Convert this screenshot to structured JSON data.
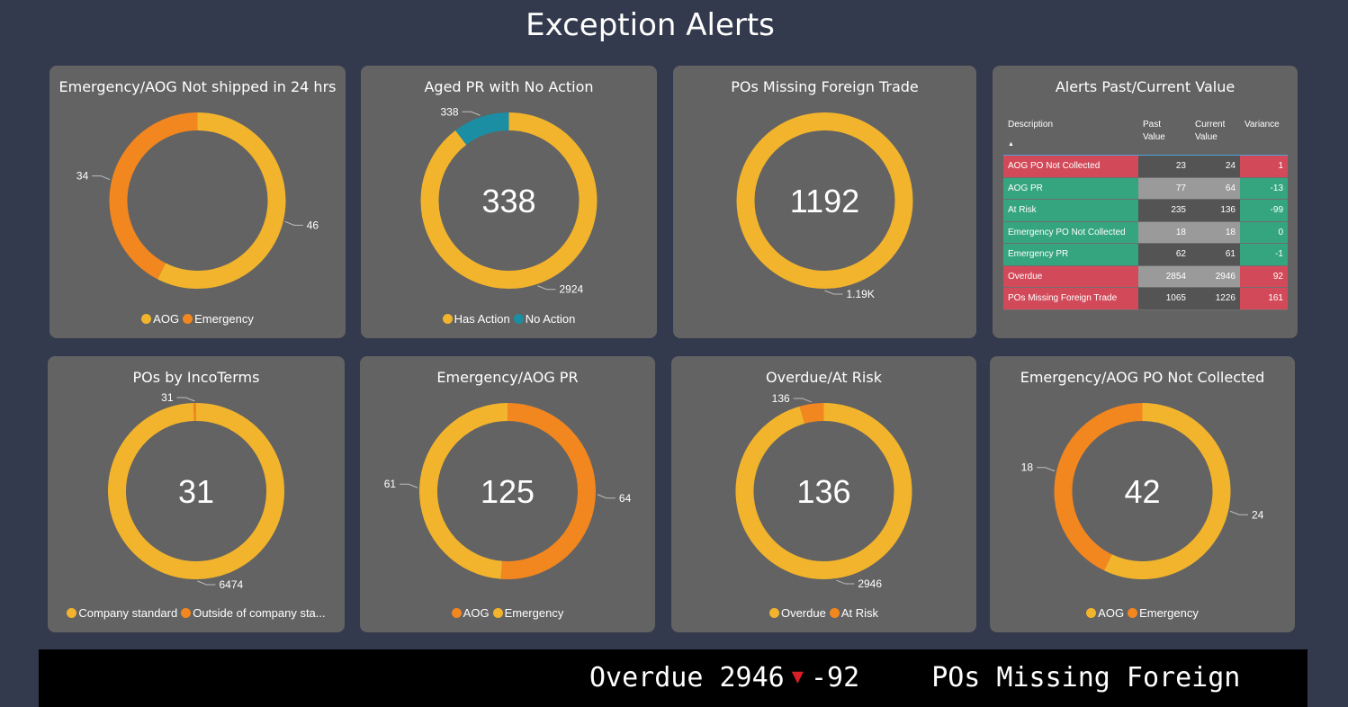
{
  "page": {
    "title": "Exception Alerts"
  },
  "colors": {
    "yellow": "#f2b42c",
    "orange": "#f2861f",
    "teal": "#1b8ea3",
    "red_cell": "#d24a59",
    "green_cell": "#35a580",
    "dark_cell": "#545454",
    "gray_cell": "#9a9a9a",
    "background": "#343a4d",
    "card": "#636363"
  },
  "charts": [
    {
      "title": "Emergency/AOG Not shipped in 24 hrs",
      "center": "",
      "slices": [
        {
          "name": "AOG",
          "value": 46,
          "label": "46",
          "color": "#f2b42c"
        },
        {
          "name": "Emergency",
          "value": 34,
          "label": "34",
          "color": "#f2861f"
        }
      ],
      "legend": [
        {
          "label": "AOG",
          "color": "#f2b42c"
        },
        {
          "label": "Emergency",
          "color": "#f2861f"
        }
      ]
    },
    {
      "title": "Aged PR with No Action",
      "center": "338",
      "slices": [
        {
          "name": "Has Action",
          "value": 2924,
          "label": "2924",
          "color": "#f2b42c"
        },
        {
          "name": "No Action",
          "value": 338,
          "label": "338",
          "color": "#1b8ea3"
        }
      ],
      "legend": [
        {
          "label": "Has Action",
          "color": "#f2b42c"
        },
        {
          "label": "No Action",
          "color": "#1b8ea3"
        }
      ]
    },
    {
      "title": "POs Missing Foreign Trade",
      "center": "1192",
      "slices": [
        {
          "name": "POs Missing Foreign Trade",
          "value": 1192,
          "label": "1.19K",
          "color": "#f2b42c"
        }
      ],
      "legend": []
    },
    {
      "title": "POs by IncoTerms",
      "center": "31",
      "slices": [
        {
          "name": "Company standard",
          "value": 6474,
          "label": "6474",
          "color": "#f2b42c"
        },
        {
          "name": "Outside of company standard",
          "value": 31,
          "label": "31",
          "color": "#f2861f"
        }
      ],
      "legend": [
        {
          "label": "Company standard",
          "color": "#f2b42c"
        },
        {
          "label": "Outside of company sta...",
          "color": "#f2861f"
        }
      ]
    },
    {
      "title": "Emergency/AOG PR",
      "center": "125",
      "slices": [
        {
          "name": "AOG",
          "value": 64,
          "label": "64",
          "color": "#f2861f"
        },
        {
          "name": "Emergency",
          "value": 61,
          "label": "61",
          "color": "#f2b42c"
        }
      ],
      "legend": [
        {
          "label": "AOG",
          "color": "#f2861f"
        },
        {
          "label": "Emergency",
          "color": "#f2b42c"
        }
      ]
    },
    {
      "title": "Overdue/At Risk",
      "center": "136",
      "slices": [
        {
          "name": "Overdue",
          "value": 2946,
          "label": "2946",
          "color": "#f2b42c"
        },
        {
          "name": "At Risk",
          "value": 136,
          "label": "136",
          "color": "#f2861f"
        }
      ],
      "legend": [
        {
          "label": "Overdue",
          "color": "#f2b42c"
        },
        {
          "label": "At Risk",
          "color": "#f2861f"
        }
      ]
    },
    {
      "title": "Emergency/AOG PO Not Collected",
      "center": "42",
      "slices": [
        {
          "name": "AOG",
          "value": 24,
          "label": "24",
          "color": "#f2b42c"
        },
        {
          "name": "Emergency",
          "value": 18,
          "label": "18",
          "color": "#f2861f"
        }
      ],
      "legend": [
        {
          "label": "AOG",
          "color": "#f2b42c"
        },
        {
          "label": "Emergency",
          "color": "#f2861f"
        }
      ]
    }
  ],
  "alerts_table": {
    "title": "Alerts Past/Current Value",
    "headers": {
      "description": "Description",
      "past": "Past\nValue",
      "current": "Current\nValue",
      "variance": "Variance"
    },
    "rows": [
      {
        "description": "AOG PO Not Collected",
        "past": "23",
        "current": "24",
        "variance": "1",
        "status": "red"
      },
      {
        "description": "AOG PR",
        "past": "77",
        "current": "64",
        "variance": "-13",
        "status": "green"
      },
      {
        "description": "At Risk",
        "past": "235",
        "current": "136",
        "variance": "-99",
        "status": "green"
      },
      {
        "description": "Emergency PO Not Collected",
        "past": "18",
        "current": "18",
        "variance": "0",
        "status": "green"
      },
      {
        "description": "Emergency PR",
        "past": "62",
        "current": "61",
        "variance": "-1",
        "status": "green"
      },
      {
        "description": "Overdue",
        "past": "2854",
        "current": "2946",
        "variance": "92",
        "status": "red"
      },
      {
        "description": "POs Missing Foreign Trade",
        "past": "1065",
        "current": "1226",
        "variance": "161",
        "status": "red"
      }
    ]
  },
  "ticker": {
    "item1_label": "Overdue 2946",
    "item1_arrow": "▼",
    "item1_value": "-92",
    "item2_label": "POs Missing Foreign"
  }
}
